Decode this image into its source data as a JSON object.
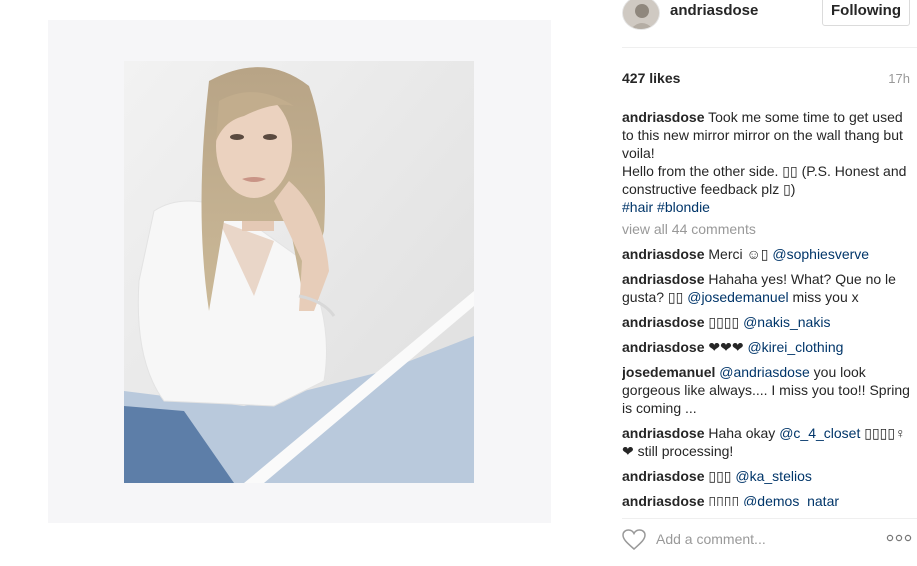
{
  "post": {
    "username": "andriasdose",
    "follow_label": "Following",
    "likes": "427 likes",
    "time": "17h"
  },
  "caption": {
    "username": "andriasdose",
    "text": "Took me some time to get used to this new mirror mirror on the wall thang but voila!",
    "line2": "Hello from the other side. ▯▯ (P.S. Honest and constructive feedback plz ▯)",
    "tag1": "#hair",
    "tag2": "#blondie"
  },
  "view_all": "view all 44 comments",
  "comments": [
    {
      "user": "andriasdose",
      "before": "Merci ☺▯ ",
      "mention": "@sophiesverve",
      "after": ""
    },
    {
      "user": "andriasdose",
      "before": "Hahaha yes! What? Que no le gusta? ▯▯ ",
      "mention": "@josedemanuel",
      "after": " miss you x"
    },
    {
      "user": "andriasdose",
      "before": "▯▯▯▯ ",
      "mention": "@nakis_nakis",
      "after": ""
    },
    {
      "user": "andriasdose",
      "before": "❤❤❤ ",
      "mention": "@kirei_clothing",
      "after": ""
    },
    {
      "user": "josedemanuel",
      "before": "",
      "mention": "@andriasdose",
      "after": " you look gorgeous like always.... I miss you too!! Spring is coming ..."
    },
    {
      "user": "andriasdose",
      "before": "Haha okay ",
      "mention": "@c_4_closet",
      "after": " ▯▯▯▯♀❤ still processing!"
    },
    {
      "user": "andriasdose",
      "before": "▯▯▯ ",
      "mention": "@ka_stelios",
      "after": ""
    },
    {
      "user": "andriasdose",
      "before": "▯▯▯▯ ",
      "mention": "@demos_natar",
      "after": ""
    }
  ],
  "footer": {
    "add_comment_placeholder": "Add a comment...",
    "more_label": "∘∘∘"
  },
  "icons": {
    "heart": "heart-icon",
    "more": "more-options-icon",
    "avatar": "avatar"
  },
  "colors": {
    "link": "#003569",
    "muted": "#999999",
    "text": "#262626"
  }
}
